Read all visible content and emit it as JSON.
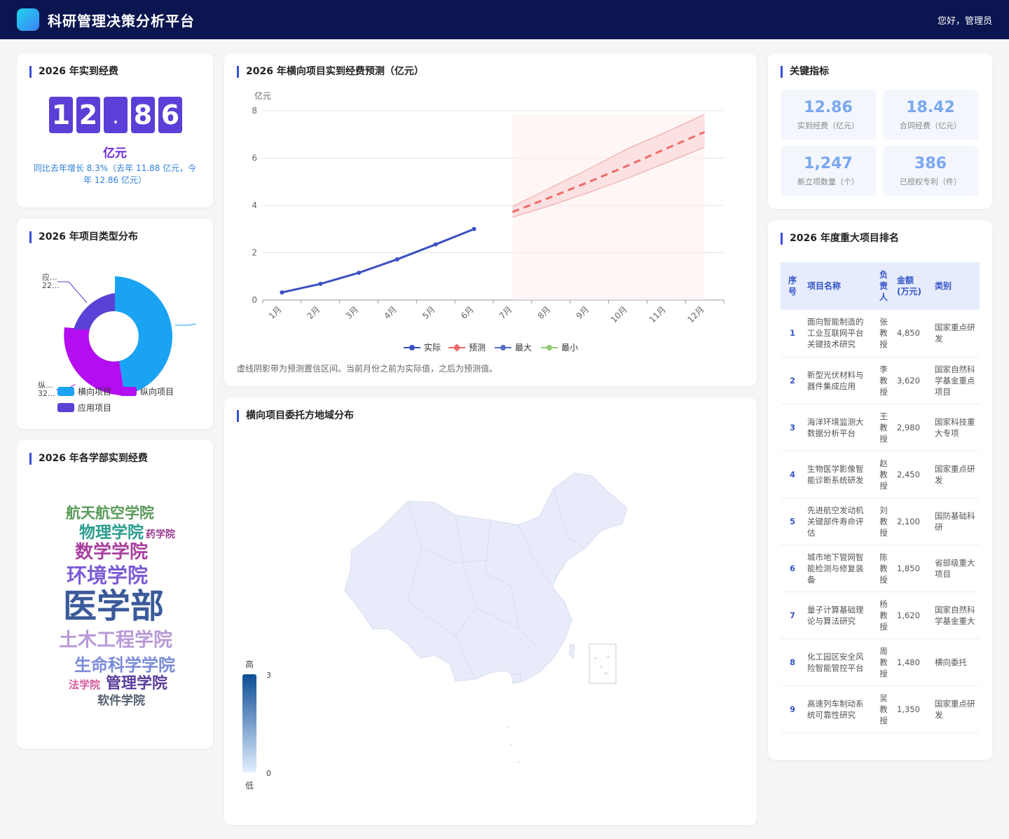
{
  "header": {
    "title": "科研管理决策分析平台",
    "greeting": "您好，管理员"
  },
  "funding": {
    "title": "2026 年实到经费",
    "digits": [
      "1",
      "2",
      ".",
      "8",
      "6"
    ],
    "unit": "亿元",
    "growth": "同比去年增长 8.3%（去年 11.88 亿元，今年 12.86 亿元）"
  },
  "project_types": {
    "title": "2026 年项目类型分布",
    "legend": [
      "横向项目",
      "纵向项目",
      "应用项目"
    ],
    "colors": [
      "#1aa3f2",
      "#b30df0",
      "#5b42d6"
    ],
    "label_top": "应...",
    "label_top_val": "22...",
    "label_bottom": "纵...",
    "label_bottom_val": "32..."
  },
  "wordcloud": {
    "title": "2026 年各学部实到经费",
    "words": [
      {
        "text": "航天航空学院",
        "color": "#5a9a5a"
      },
      {
        "text": "物理学院",
        "color": "#2a9d8f"
      },
      {
        "text": "药学院",
        "color": "#9b3d8f"
      },
      {
        "text": "数学学院",
        "color": "#a83fa0"
      },
      {
        "text": "环境学院",
        "color": "#7c5cd6"
      },
      {
        "text": "医学部",
        "color": "#3b5a9a"
      },
      {
        "text": "土木工程学院",
        "color": "#b89ad8"
      },
      {
        "text": "生命科学学院",
        "color": "#7a8ad8"
      },
      {
        "text": "法学院",
        "color": "#d45a9a"
      },
      {
        "text": "管理学院",
        "color": "#5a3d9a"
      },
      {
        "text": "软件学院",
        "color": "#556070"
      }
    ]
  },
  "forecast": {
    "title": "2026 年横向项目实到经费预测（亿元）",
    "note": "虚线阴影带为预测置信区间。当前月份之前为实际值，之后为预测值。"
  },
  "chart_data": {
    "type": "line",
    "x": [
      "1月",
      "2月",
      "3月",
      "4月",
      "5月",
      "6月",
      "7月",
      "8月",
      "9月",
      "10月",
      "11月",
      "12月"
    ],
    "ylabel": "亿元",
    "ylim": [
      0,
      8
    ],
    "yticks": [
      0,
      2,
      4,
      6,
      8
    ],
    "grid": true,
    "legend_position": "bottom",
    "series": [
      {
        "name": "实际",
        "color": "#3b4fc4",
        "values": [
          0.32,
          0.68,
          1.15,
          1.72,
          2.35,
          3.0,
          null,
          null,
          null,
          null,
          null,
          null
        ]
      },
      {
        "name": "预测",
        "color": "#ef6b6b",
        "values": [
          null,
          null,
          null,
          null,
          null,
          null,
          3.72,
          4.35,
          5.0,
          5.68,
          6.4,
          7.1
        ]
      },
      {
        "name": "最大",
        "color": "#5470c6",
        "values": [
          null,
          null,
          null,
          null,
          null,
          null,
          3.95,
          4.75,
          5.55,
          6.4,
          7.1,
          7.85
        ]
      },
      {
        "name": "最小",
        "color": "#91cc75",
        "values": [
          null,
          null,
          null,
          null,
          null,
          null,
          3.5,
          4.0,
          4.55,
          5.15,
          5.8,
          6.45
        ]
      }
    ]
  },
  "map": {
    "title": "横向项目委托方地域分布",
    "legend_high": "高",
    "legend_low": "低",
    "max": "3",
    "min": "0"
  },
  "kpis": {
    "title": "关键指标",
    "items": [
      {
        "value": "12.86",
        "label": "实到经费（亿元）"
      },
      {
        "value": "18.42",
        "label": "合同经费（亿元）"
      },
      {
        "value": "1,247",
        "label": "新立项数量（个）"
      },
      {
        "value": "386",
        "label": "已授权专利（件）"
      }
    ]
  },
  "ranking": {
    "title": "2026 年度重大项目排名",
    "headers": [
      "序号",
      "项目名称",
      "负责人",
      "金额 (万元)",
      "类别"
    ],
    "rows": [
      {
        "no": "1",
        "name": "面向智能制造的工业互联网平台关键技术研究",
        "lead": "张教授",
        "amount": "4,850",
        "type": "国家重点研发"
      },
      {
        "no": "2",
        "name": "新型光伏材料与器件集成应用",
        "lead": "李教授",
        "amount": "3,620",
        "type": "国家自然科学基金重点项目"
      },
      {
        "no": "3",
        "name": "海洋环境监测大数据分析平台",
        "lead": "王教授",
        "amount": "2,980",
        "type": "国家科技重大专项"
      },
      {
        "no": "4",
        "name": "生物医学影像智能诊断系统研发",
        "lead": "赵教授",
        "amount": "2,450",
        "type": "国家重点研发"
      },
      {
        "no": "5",
        "name": "先进航空发动机关键部件寿命评估",
        "lead": "刘教授",
        "amount": "2,100",
        "type": "国防基础科研"
      },
      {
        "no": "6",
        "name": "城市地下管网智能检测与修复装备",
        "lead": "陈教授",
        "amount": "1,850",
        "type": "省部级重大项目"
      },
      {
        "no": "7",
        "name": "量子计算基础理论与算法研究",
        "lead": "杨教授",
        "amount": "1,620",
        "type": "国家自然科学基金重大"
      },
      {
        "no": "8",
        "name": "化工园区安全风险智能管控平台",
        "lead": "周教授",
        "amount": "1,480",
        "type": "横向委托"
      },
      {
        "no": "9",
        "name": "高速列车制动系统可靠性研究",
        "lead": "吴教授",
        "amount": "1,350",
        "type": "国家重点研发"
      }
    ]
  }
}
